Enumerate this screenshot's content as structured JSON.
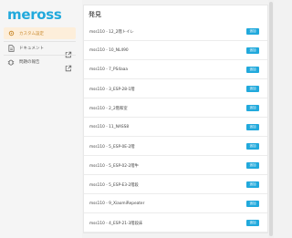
{
  "app": {
    "logo": "meross"
  },
  "sidebar": {
    "items": [
      {
        "label": "カスタム設定",
        "icon": "settings-icon",
        "active": true
      },
      {
        "label": "ドキュメント",
        "icon": "document-icon",
        "external": true
      },
      {
        "label": "問題の報告",
        "icon": "bug-icon",
        "external": true
      }
    ]
  },
  "main": {
    "title": "発見",
    "button_label": "追加",
    "devices": [
      "mss110 - 12_2階トイレ",
      "mss110 - 10_NL490",
      "mss110 - 7_PS4aaa",
      "mss110 - 3_ESP-28-1階",
      "mss110 - 2_2階和室",
      "mss110 - 11_NASS8",
      "mss110 - 5_ESP-0E-2階",
      "mss110 - 5_ESP-02-2階牛",
      "mss110 - 5_ESP-E3-2階段",
      "mss110 - 9_XiaomiRepeater",
      "mss110 - 4_ESP-21-3階段床"
    ]
  },
  "colors": {
    "accent": "#21a9dc",
    "active_bg": "#fdeeda",
    "active_text": "#c98a2d"
  }
}
